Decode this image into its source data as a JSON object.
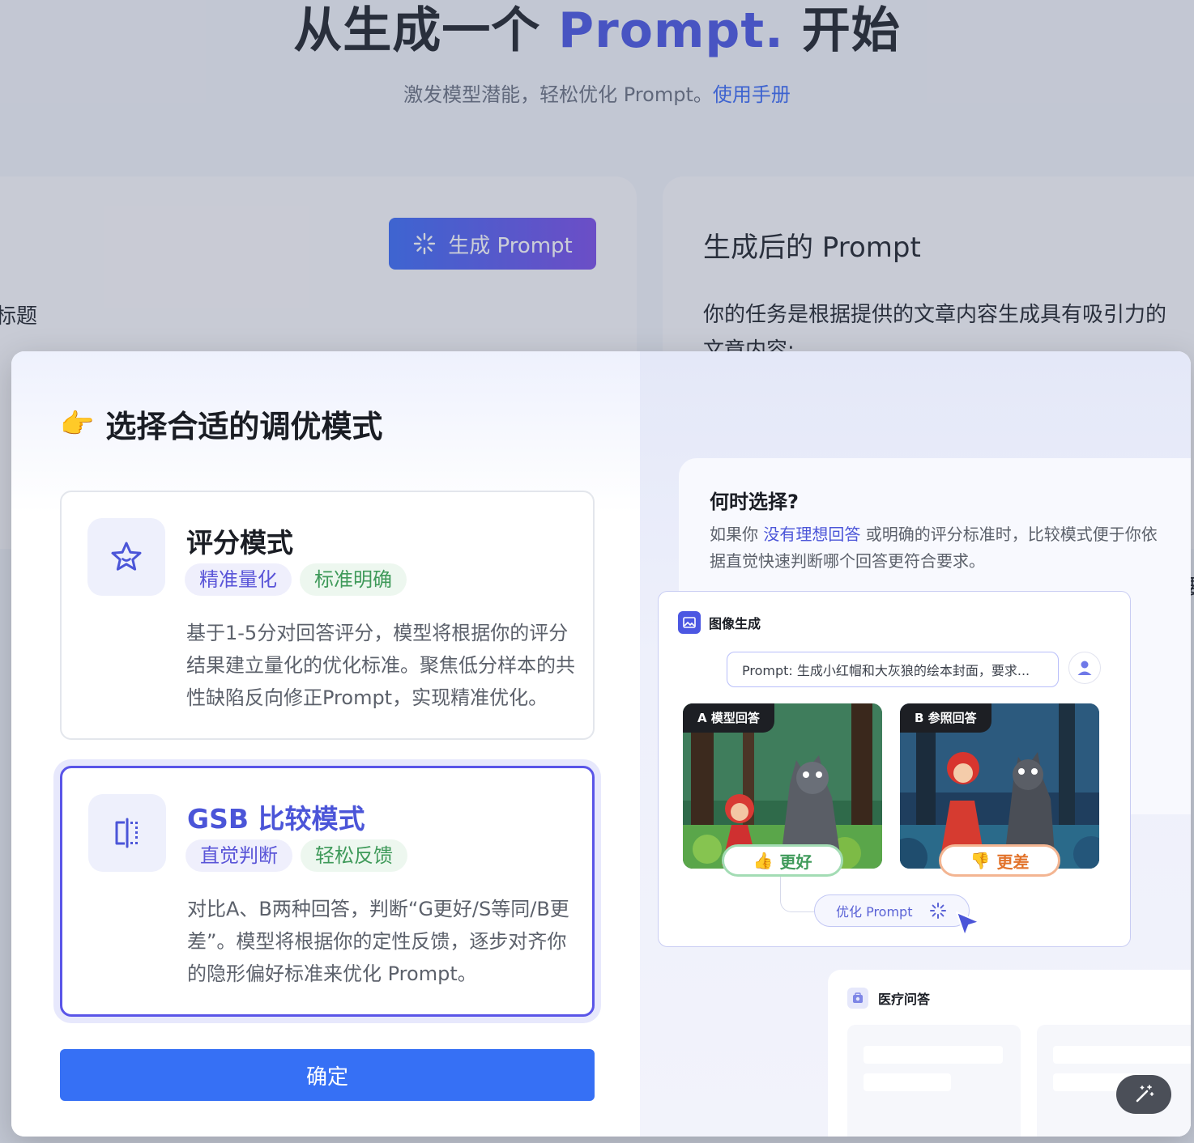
{
  "hero": {
    "title_main": "从生成一个 ",
    "title_accent": "Prompt.",
    "title_end": " 开始",
    "subtitle": "激发模型潜能，轻松优化 Prompt。",
    "subtitle_link": "使用手册"
  },
  "background": {
    "generate_button": "生成 Prompt",
    "left_fragment": "标题",
    "right_title": "生成后的 Prompt",
    "right_text_line1": "你的任务是根据提供的文章内容生成具有吸引力的",
    "right_text_line2": "文章内容:",
    "right_fragment": "要"
  },
  "modal": {
    "title": "选择合适的调优模式",
    "pointing_icon": "👉",
    "modes": [
      {
        "name": "评分模式",
        "icon": "star-icon",
        "tags": [
          "精准量化",
          "标准明确"
        ],
        "description": "基于1-5分对回答评分，模型将根据你的评分结果建立量化的优化标准。聚焦低分样本的共性缺陷反向修正Prompt，实现精准优化。"
      },
      {
        "name": "GSB 比较模式",
        "icon": "compare-icon",
        "tags": [
          "直觉判断",
          "轻松反馈"
        ],
        "description": "对比A、B两种回答，判断“G更好/S等同/B更差”。模型将根据你的定性反馈，逐步对齐你的隐形偏好标准来优化 Prompt。"
      }
    ],
    "confirm_label": "确定",
    "preview": {
      "when_title": "何时选择?",
      "when_text_prefix": "如果你 ",
      "when_text_highlight": "没有理想回答",
      "when_text_suffix": " 或明确的评分标准时，比较模式便于你依据直觉快速判断哪个回答更符合要求。",
      "demo_title": "图像生成",
      "demo_prompt": "Prompt:  生成小红帽和大灰狼的绘本封面，要求...",
      "answer_a_label": "A 模型回答",
      "answer_b_label": "B 参照回答",
      "verdict_good": "更好",
      "verdict_bad": "更差",
      "optimize_label": "优化 Prompt",
      "second_demo_title": "医疗问答"
    }
  },
  "colors": {
    "accent": "#4a56e2",
    "primary_button": "#3670f5",
    "selected_border": "#5a55e8",
    "good": "#3f9a5a",
    "bad": "#e2732b"
  }
}
